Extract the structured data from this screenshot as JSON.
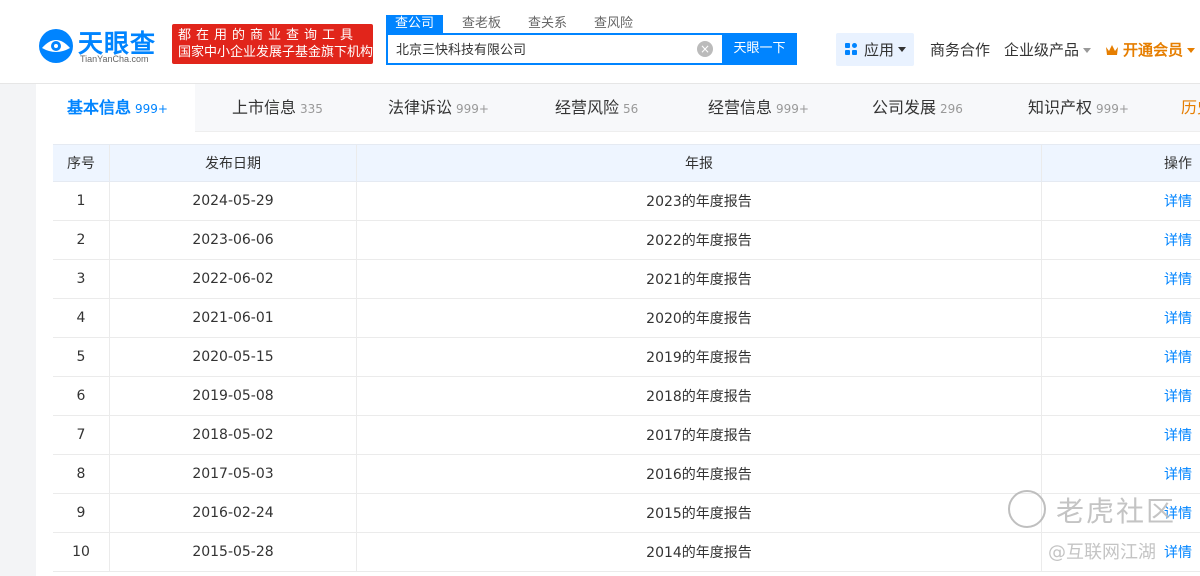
{
  "header": {
    "logo_text": "天眼查",
    "logo_sub": "TianYanCha.com",
    "slogan_line1": "都在用的商业查询工具",
    "slogan_line2": "国家中小企业发展子基金旗下机构",
    "search_tabs": [
      "查公司",
      "查老板",
      "查关系",
      "查风险"
    ],
    "search_value": "北京三快科技有限公司",
    "search_button": "天眼一下",
    "clear_symbol": "×",
    "nav": {
      "apps": "应用",
      "business": "商务合作",
      "enterprise": "企业级产品",
      "vip": "开通会员"
    }
  },
  "tabs": [
    {
      "label": "基本信息",
      "count": "999+"
    },
    {
      "label": "上市信息",
      "count": "335"
    },
    {
      "label": "法律诉讼",
      "count": "999+"
    },
    {
      "label": "经营风险",
      "count": "56"
    },
    {
      "label": "经营信息",
      "count": "999+"
    },
    {
      "label": "公司发展",
      "count": "296"
    },
    {
      "label": "知识产权",
      "count": "999+"
    },
    {
      "label": "历史",
      "count": ""
    }
  ],
  "table": {
    "columns": {
      "idx": "序号",
      "date": "发布日期",
      "report": "年报",
      "op": "操作"
    },
    "rows": [
      {
        "idx": "1",
        "date": "2024-05-29",
        "report": "2023的年度报告",
        "op": "详情"
      },
      {
        "idx": "2",
        "date": "2023-06-06",
        "report": "2022的年度报告",
        "op": "详情"
      },
      {
        "idx": "3",
        "date": "2022-06-02",
        "report": "2021的年度报告",
        "op": "详情"
      },
      {
        "idx": "4",
        "date": "2021-06-01",
        "report": "2020的年度报告",
        "op": "详情"
      },
      {
        "idx": "5",
        "date": "2020-05-15",
        "report": "2019的年度报告",
        "op": "详情"
      },
      {
        "idx": "6",
        "date": "2019-05-08",
        "report": "2018的年度报告",
        "op": "详情"
      },
      {
        "idx": "7",
        "date": "2018-05-02",
        "report": "2017的年度报告",
        "op": "详情"
      },
      {
        "idx": "8",
        "date": "2017-05-03",
        "report": "2016的年度报告",
        "op": "详情"
      },
      {
        "idx": "9",
        "date": "2016-02-24",
        "report": "2015的年度报告",
        "op": "详情"
      },
      {
        "idx": "10",
        "date": "2015-05-28",
        "report": "2014的年度报告",
        "op": "详情"
      }
    ]
  },
  "watermark": {
    "line1": "老虎社区",
    "line2": "@互联网江湖"
  },
  "colors": {
    "brand": "#0084ff",
    "slogan_bg": "#e1251b",
    "vip": "#e67e00"
  }
}
